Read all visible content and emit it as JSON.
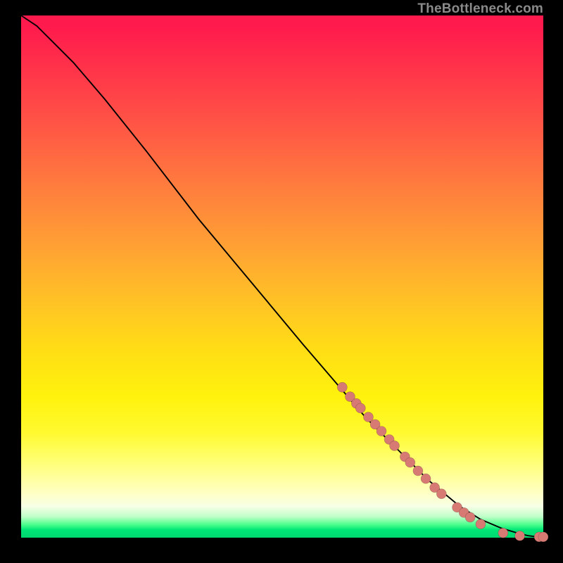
{
  "watermark": "TheBottleneck.com",
  "chart_data": {
    "type": "line",
    "title": "",
    "xlabel": "",
    "ylabel": "",
    "xlim": [
      0,
      100
    ],
    "ylim": [
      0,
      100
    ],
    "grid": false,
    "legend": false,
    "background": "heat-gradient-red-yellow-green",
    "series": [
      {
        "name": "curve",
        "kind": "line",
        "x": [
          0,
          3,
          6,
          10,
          16,
          24,
          34,
          44,
          54,
          60,
          66,
          72,
          78,
          84,
          88,
          92,
          95,
          97,
          98.5,
          100
        ],
        "y": [
          100,
          98,
          95,
          91,
          84,
          74,
          61,
          49,
          37,
          30,
          23,
          17,
          11,
          6,
          3.5,
          1.8,
          0.9,
          0.4,
          0.2,
          0.15
        ]
      },
      {
        "name": "cluster-points",
        "kind": "scatter",
        "x": [
          61.5,
          63.0,
          64.2,
          65.0,
          66.5,
          67.8,
          69.0,
          70.5,
          71.5,
          73.5,
          74.5,
          76.0,
          77.5,
          79.2,
          80.5,
          83.5,
          84.8,
          86.0,
          88.0,
          92.3,
          95.5,
          99.2,
          100.0
        ],
        "y": [
          28.8,
          27.0,
          25.7,
          24.8,
          23.1,
          21.7,
          20.4,
          18.8,
          17.6,
          15.5,
          14.4,
          12.8,
          11.3,
          9.6,
          8.4,
          5.8,
          4.8,
          3.9,
          2.6,
          0.9,
          0.35,
          0.15,
          0.15
        ]
      }
    ]
  }
}
